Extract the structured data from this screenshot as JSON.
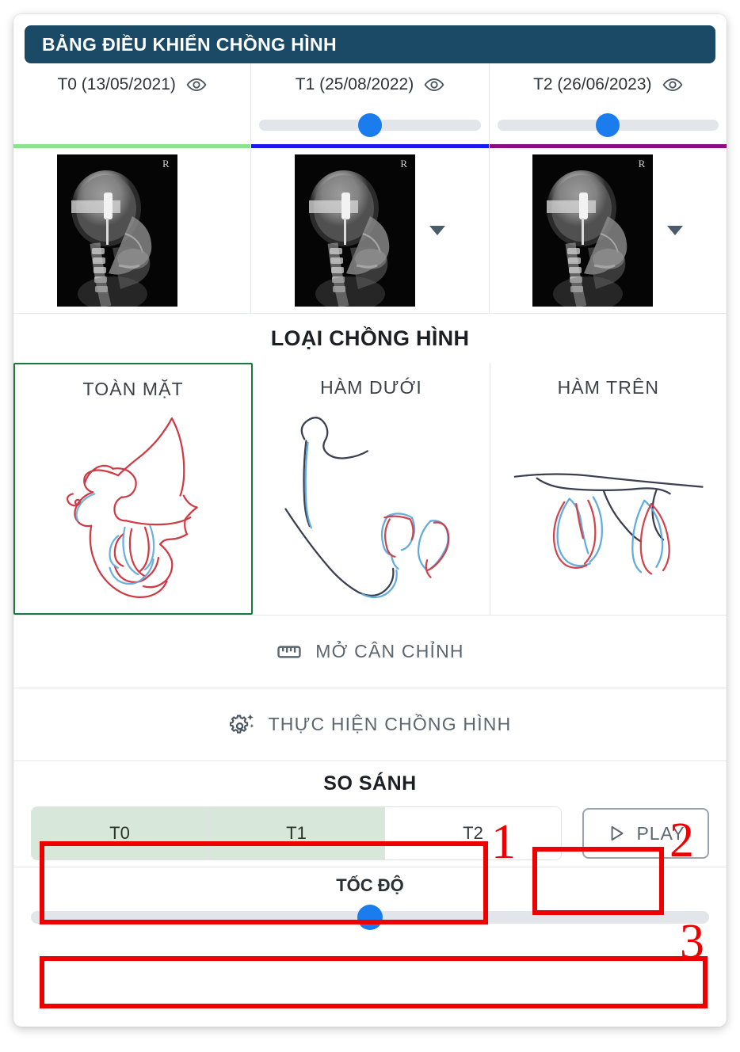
{
  "header": {
    "title": "BẢNG ĐIỀU KHIỂN CHỒNG HÌNH"
  },
  "timepoints": [
    {
      "label": "T0 (13/05/2021)",
      "visibility_icon": "eye-icon",
      "color": "#8fe08f",
      "has_slider": false,
      "slider_percent": 0,
      "has_caret": false,
      "thumbnail_marker": "R"
    },
    {
      "label": "T1 (25/08/2022)",
      "visibility_icon": "eye-icon",
      "color": "#1a1af0",
      "has_slider": true,
      "slider_percent": 50,
      "has_caret": true,
      "thumbnail_marker": "R"
    },
    {
      "label": "T2 (26/06/2023)",
      "visibility_icon": "eye-icon",
      "color": "#8e0a7e",
      "has_slider": true,
      "slider_percent": 50,
      "has_caret": true,
      "thumbnail_marker": "R"
    }
  ],
  "superimposition": {
    "section_title": "LOẠI CHỒNG HÌNH",
    "types": [
      {
        "label": "TOÀN MẶT",
        "selected": true,
        "selected_border_color": "#1a7a3c"
      },
      {
        "label": "HÀM DƯỚI",
        "selected": false,
        "selected_border_color": "#1a7a3c"
      },
      {
        "label": "HÀM TRÊN",
        "selected": false,
        "selected_border_color": "#1a7a3c"
      }
    ]
  },
  "actions": [
    {
      "label": "MỞ CÂN CHỈNH",
      "icon": "ruler-icon"
    },
    {
      "label": "THỰC HIỆN CHỒNG HÌNH",
      "icon": "gear-sparkle-icon"
    }
  ],
  "compare": {
    "title": "SO SÁNH",
    "segments": [
      {
        "label": "T0",
        "active": true
      },
      {
        "label": "T1",
        "active": true
      },
      {
        "label": "T2",
        "active": false
      }
    ],
    "play": {
      "label": "PLAY",
      "icon": "play-triangle-icon"
    },
    "active_color": "#d7e7da"
  },
  "speed": {
    "title": "TỐC ĐỘ",
    "value_percent": 50
  },
  "annotations": [
    {
      "number": "1",
      "target": "compare-segmented-control"
    },
    {
      "number": "2",
      "target": "play-button"
    },
    {
      "number": "3",
      "target": "speed-slider"
    }
  ],
  "tracing_colors": {
    "red": "#cf3a44",
    "blue": "#5aa8dc",
    "dark": "#3a3f52"
  }
}
